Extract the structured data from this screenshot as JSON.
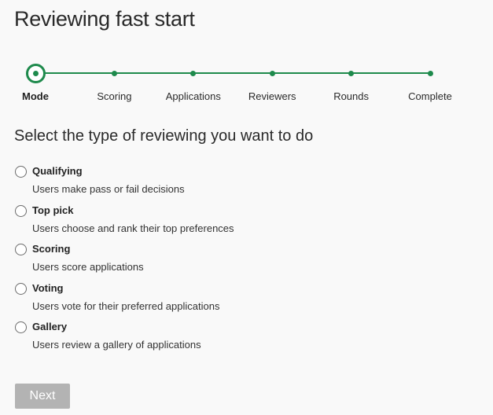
{
  "page": {
    "title": "Reviewing fast start"
  },
  "stepper": {
    "accent_color": "#1e8a4c",
    "current_index": 0,
    "steps": [
      {
        "label": "Mode"
      },
      {
        "label": "Scoring"
      },
      {
        "label": "Applications"
      },
      {
        "label": "Reviewers"
      },
      {
        "label": "Rounds"
      },
      {
        "label": "Complete"
      }
    ]
  },
  "main": {
    "heading": "Select the type of reviewing you want to do",
    "options": [
      {
        "title": "Qualifying",
        "description": "Users make pass or fail decisions",
        "selected": false
      },
      {
        "title": "Top pick",
        "description": "Users choose and rank their top preferences",
        "selected": false
      },
      {
        "title": "Scoring",
        "description": "Users score applications",
        "selected": false
      },
      {
        "title": "Voting",
        "description": "Users vote for their preferred applications",
        "selected": false
      },
      {
        "title": "Gallery",
        "description": "Users review a gallery of applications",
        "selected": false
      }
    ]
  },
  "actions": {
    "next_label": "Next",
    "next_disabled": true
  }
}
